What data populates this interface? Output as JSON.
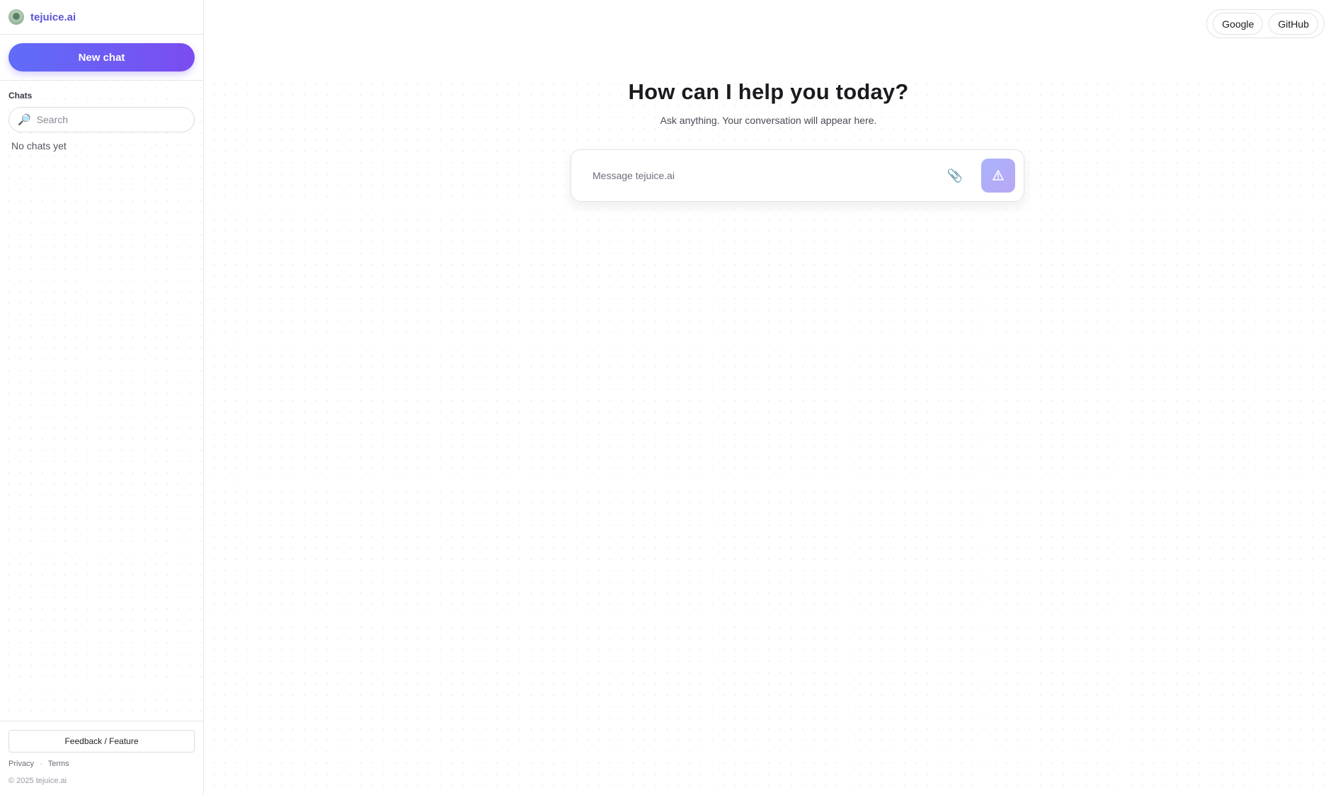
{
  "brand": {
    "name": "tejuice.ai"
  },
  "sidebar": {
    "new_chat_label": "New chat",
    "chats_heading": "Chats",
    "search_placeholder": "Search",
    "empty_state": "No chats yet",
    "feedback_label": "Feedback / Feature",
    "privacy_label": "Privacy",
    "separator": "·",
    "terms_label": "Terms",
    "copyright": "© 2025 tejuice.ai"
  },
  "header": {
    "google_label": "Google",
    "github_label": "GitHub"
  },
  "main": {
    "title": "How can I help you today?",
    "subtitle": "Ask anything. Your conversation will appear here.",
    "message_placeholder": "Message tejuice.ai"
  },
  "icons": {
    "search": "search-icon",
    "attach": "paperclip-icon",
    "send": "send-icon",
    "logo": "brand-logo-icon"
  },
  "colors": {
    "accent_start": "#5f6df8",
    "accent_end": "#7b4cf0",
    "brand_text": "#5b53d6"
  }
}
